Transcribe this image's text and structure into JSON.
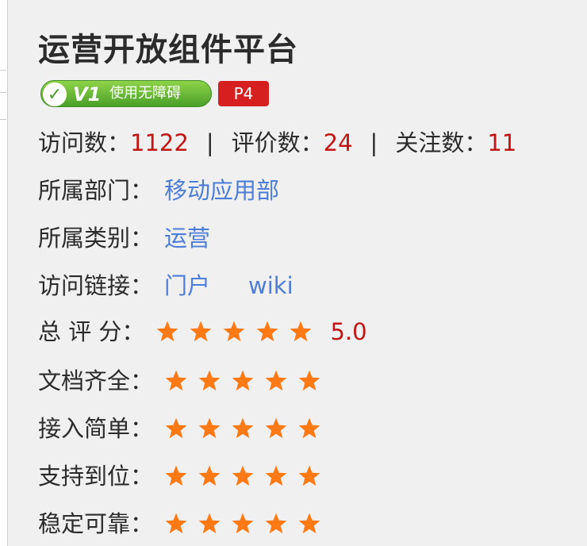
{
  "title": "运营开放组件平台",
  "accessibility_badge": {
    "version": "V1",
    "label": "使用无障碍"
  },
  "priority_badge": "P4",
  "stats": {
    "visits_label": "访问数：",
    "visits": "1122",
    "separator": "|",
    "reviews_label": "评价数：",
    "reviews": "24",
    "followers_label": "关注数：",
    "followers": "11"
  },
  "department": {
    "label": "所属部门：",
    "value": "移动应用部"
  },
  "category": {
    "label": "所属类别：",
    "value": "运营"
  },
  "links": {
    "label": "访问链接：",
    "portal": "门户",
    "wiki": "wiki"
  },
  "overall": {
    "label": "总 评 分：",
    "stars": 5,
    "score": "5.0"
  },
  "ratings": [
    {
      "label": "文档齐全：",
      "stars": 5
    },
    {
      "label": "接入简单：",
      "stars": 5
    },
    {
      "label": "支持到位：",
      "stars": 5
    },
    {
      "label": "稳定可靠：",
      "stars": 5
    }
  ],
  "colors": {
    "star": "#ff7a14",
    "value_red": "#c01616",
    "link_blue": "#4d7dd6",
    "badge_green": "#4aa02a",
    "badge_red": "#d62020"
  },
  "icons": {
    "star": "star-icon",
    "check": "check-circle-icon"
  }
}
